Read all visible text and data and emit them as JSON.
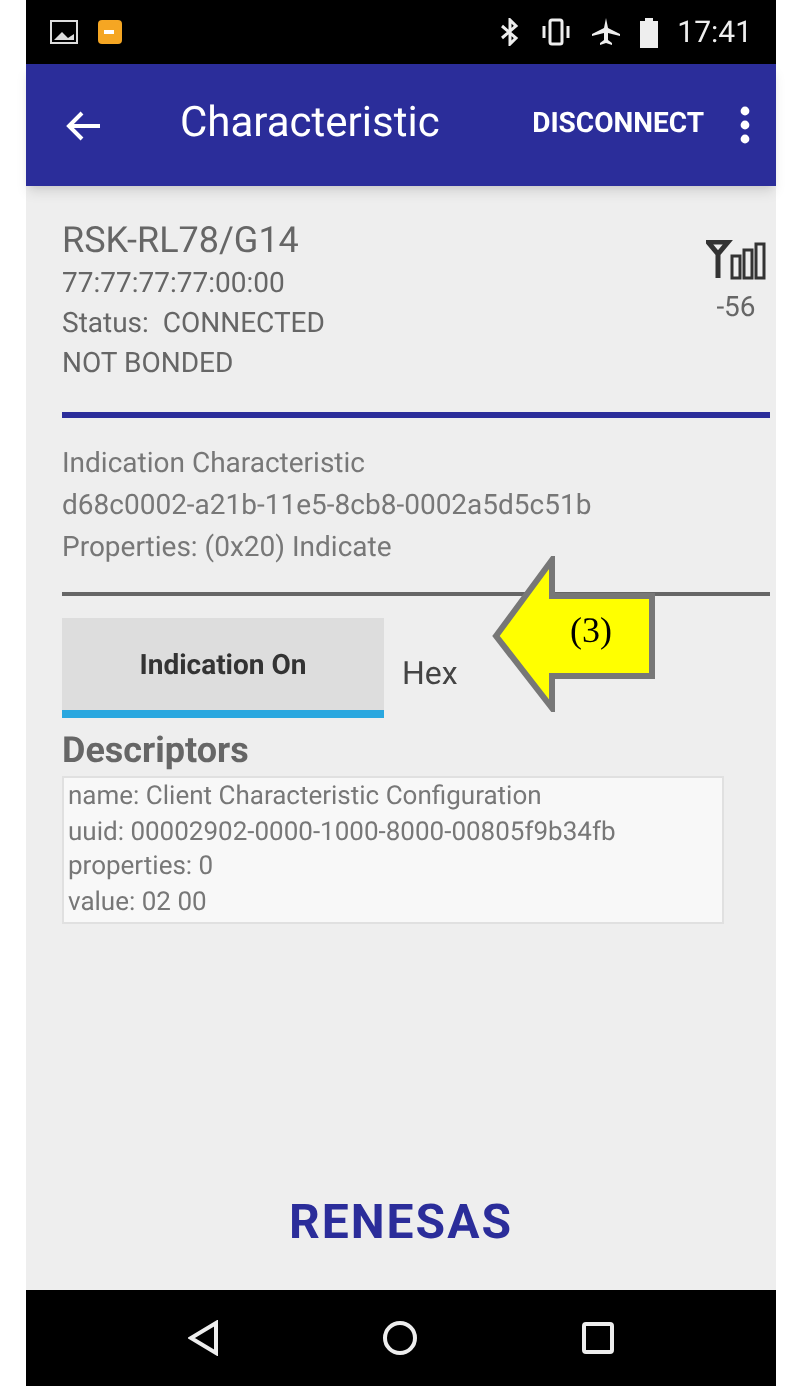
{
  "status_bar": {
    "time": "17:41"
  },
  "app_bar": {
    "title": "Characteristic",
    "action": "DISCONNECT"
  },
  "device": {
    "name": "RSK-RL78/G14",
    "address": "77:77:77:77:00:00",
    "status": "Status:  CONNECTED",
    "bond": "NOT BONDED",
    "rssi": "-56"
  },
  "characteristic": {
    "name": "Indication Characteristic",
    "uuid": "d68c0002-a21b-11e5-8cb8-0002a5d5c51b",
    "properties": "Properties: (0x20) Indicate"
  },
  "tabs": [
    {
      "label": "Indication On",
      "selected": true
    },
    {
      "label": "Hex",
      "selected": false
    }
  ],
  "callout": {
    "label": "(3)"
  },
  "descriptors": {
    "heading": "Descriptors",
    "lines": [
      "name: Client Characteristic Configuration",
      "uuid: 00002902-0000-1000-8000-00805f9b34fb",
      "properties: 0",
      "value: 02 00"
    ]
  },
  "logo": {
    "text": "RENESAS"
  }
}
